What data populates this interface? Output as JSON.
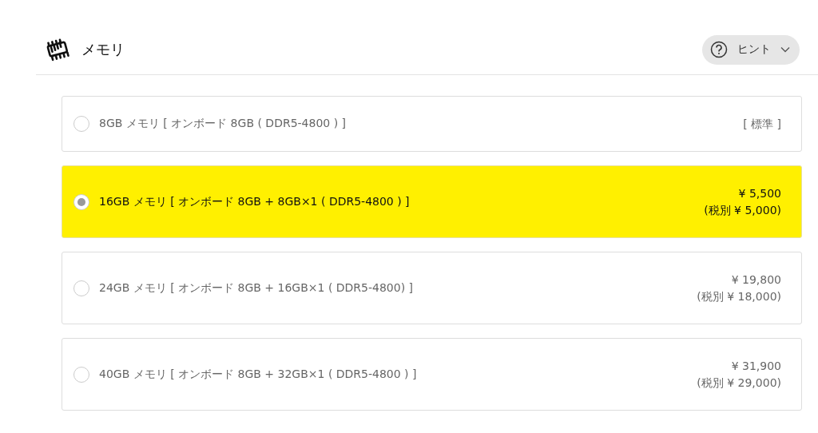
{
  "header": {
    "title": "メモリ",
    "hint_button": {
      "label": "ヒント",
      "expanded": false
    }
  },
  "options": [
    {
      "label": "8GB メモリ [ オンボード 8GB ( DDR5-4800 ) ]",
      "price_lines": [
        "[ 標準 ]"
      ],
      "selected": false
    },
    {
      "label": "16GB メモリ [ オンボード 8GB + 8GB×1 ( DDR5-4800 ) ]",
      "price_lines": [
        "¥ 5,500",
        "(税別 ¥ 5,000)"
      ],
      "selected": true
    },
    {
      "label": "24GB メモリ [ オンボード 8GB + 16GB×1 ( DDR5-4800) ]",
      "price_lines": [
        "¥ 19,800",
        "(税別 ¥ 18,000)"
      ],
      "selected": false
    },
    {
      "label": "40GB メモリ [ オンボード 8GB + 32GB×1 ( DDR5-4800 ) ]",
      "price_lines": [
        "¥ 31,900",
        "(税別 ¥ 29,000)"
      ],
      "selected": false
    }
  ]
}
